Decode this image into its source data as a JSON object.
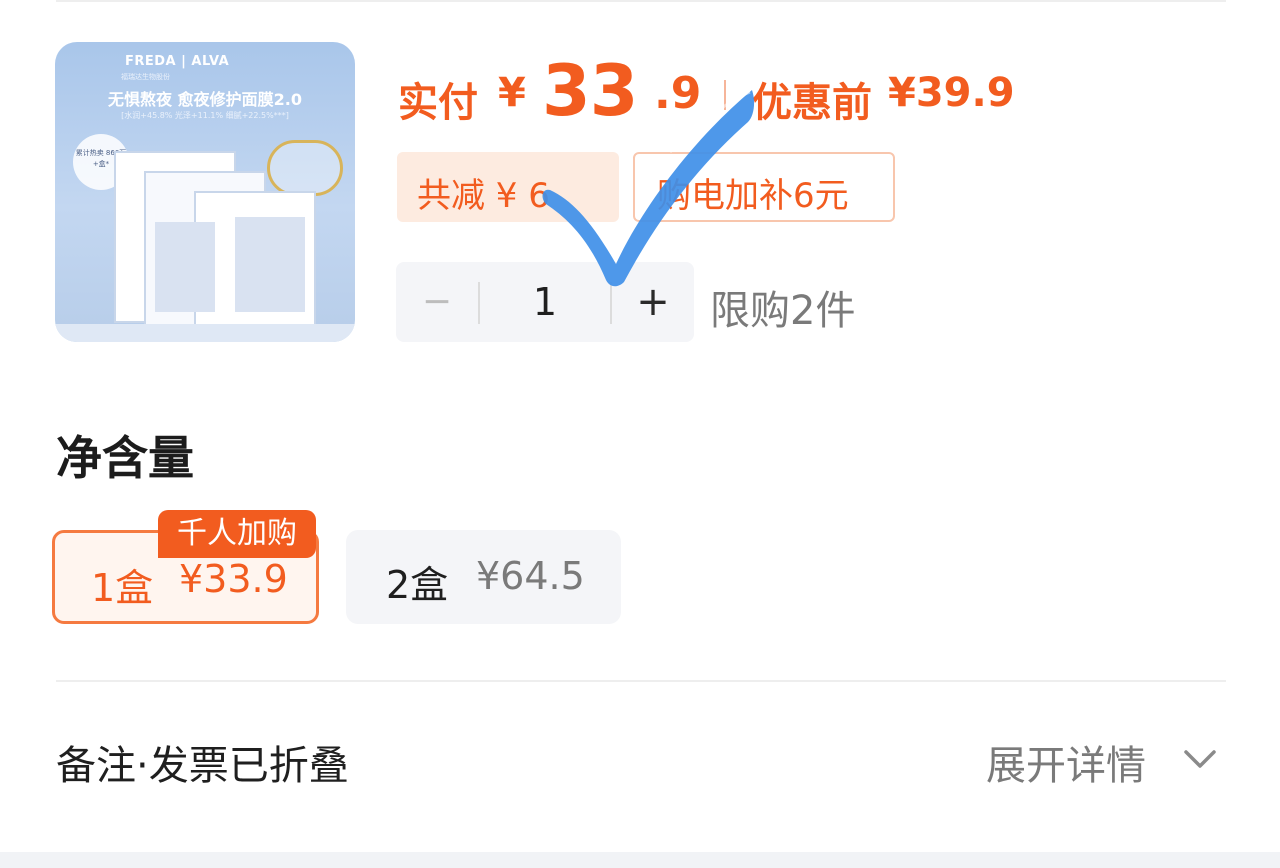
{
  "product": {
    "image": {
      "brand": "FREDA | ALVA",
      "brand_sub": "福瑞达生物股份",
      "headline": "无惧熬夜 愈夜修护面膜2.0",
      "stats": "[水润+45.8% 光泽+11.1% 细腻+22.5%***]",
      "badge_text": "累计热卖 860万+盒*"
    }
  },
  "price": {
    "pay_label": "实付",
    "yen": "¥",
    "pay_int": "33",
    "pay_dec": ".9",
    "original_label": "优惠前",
    "original_price": "¥39.9"
  },
  "chips": {
    "discount": "共减 ¥ 6",
    "subsidy": "购电加补6元"
  },
  "stepper": {
    "minus": "−",
    "quantity": "1",
    "plus": "+",
    "limit": "限购2件"
  },
  "spec": {
    "title": "净含量",
    "badge": "千人加购",
    "options": [
      {
        "qty": "1盒",
        "price": "¥33.9",
        "selected": true
      },
      {
        "qty": "2盒",
        "price": "¥64.5",
        "selected": false
      }
    ]
  },
  "notes": {
    "label": "备注·发票已折叠",
    "expand": "展开详情"
  },
  "colors": {
    "accent": "#f25c1f",
    "chip_bg": "#fdebe0",
    "stepper_bg": "#f4f5f8",
    "check_blue": "#3f8fe8"
  }
}
